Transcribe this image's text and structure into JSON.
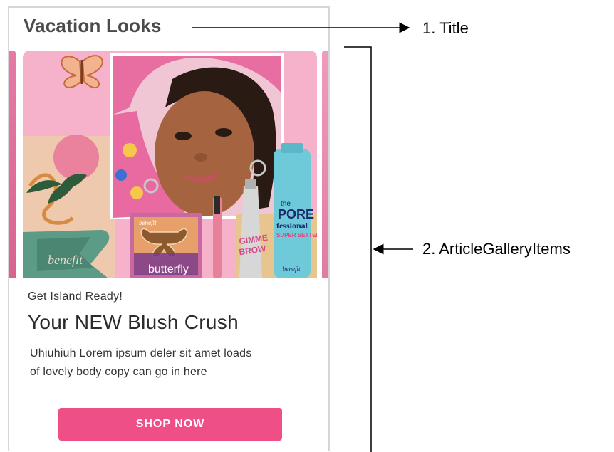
{
  "gallery": {
    "title": "Vacation Looks",
    "item": {
      "eyebrow": "Get Island Ready!",
      "headline": "Your NEW Blush Crush",
      "body_line1": "Uhiuhiuh Lorem ipsum deler sit amet loads",
      "body_line2": "of lovely body copy can go in here",
      "cta_label": "SHOP NOW",
      "image_text": {
        "compact_brand": "benefit",
        "palette_name": "butterfly",
        "palette_brand": "benefit",
        "brow_line1": "GIMME",
        "brow_line2": "BROW",
        "spray_line1": "the",
        "spray_line2": "PORE",
        "spray_line3": "fessional",
        "spray_line4": "SUPER SETTER",
        "spray_brand": "benefit"
      }
    }
  },
  "annotations": {
    "title_label": "1. Title",
    "items_label": "2. ArticleGalleryItems"
  },
  "colors": {
    "accent": "#ee4f86",
    "title": "#4b4b4b",
    "border": "#d6d6d6"
  }
}
